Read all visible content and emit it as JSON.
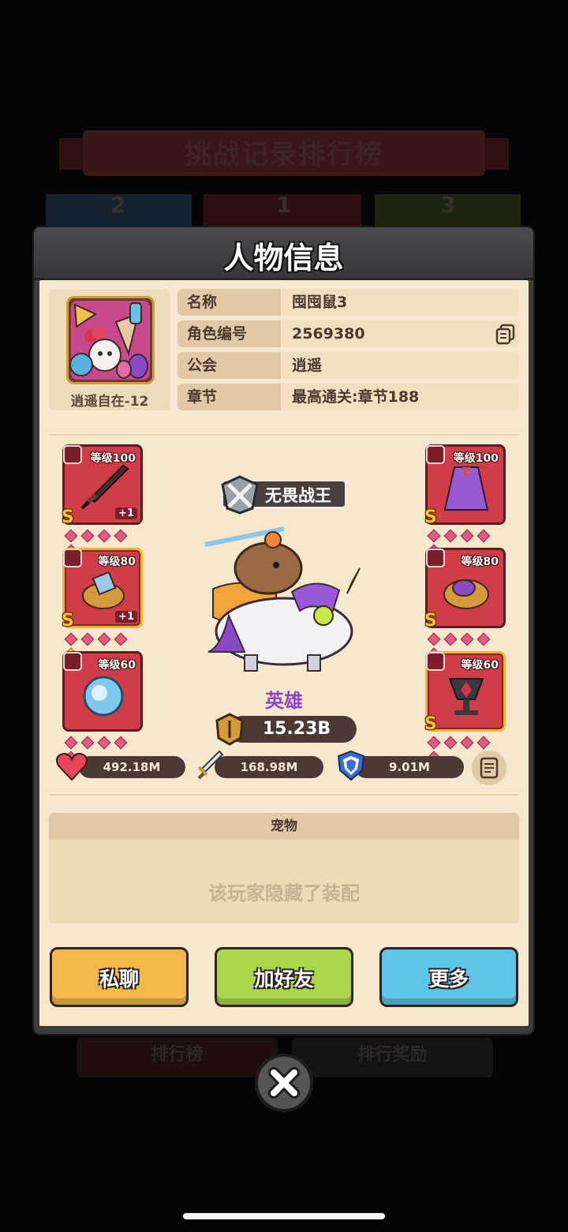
{
  "background": {
    "title": "挑战记录排行榜",
    "podium": [
      "2",
      "1",
      "3"
    ],
    "bottom_tabs": [
      "排行榜",
      "排行奖励"
    ]
  },
  "dialog": {
    "title": "人物信息"
  },
  "profile": {
    "avatar_label": "逍遥自在-12",
    "rows": [
      {
        "key": "名称",
        "value": "囤囤鼠3"
      },
      {
        "key": "角色编号",
        "value": "2569380"
      },
      {
        "key": "公会",
        "value": "逍遥"
      },
      {
        "key": "章节",
        "value": "最高通关:章节188"
      }
    ]
  },
  "equipment": {
    "left": [
      {
        "level": "等级100",
        "grade": "S",
        "plus": "+1",
        "slot": "weapon",
        "gems_filled": 5
      },
      {
        "level": "等级80",
        "grade": "S",
        "plus": "+1",
        "slot": "ring",
        "gems_filled": 4
      },
      {
        "level": "等级60",
        "grade": "",
        "plus": "",
        "slot": "necklace",
        "gems_filled": 5
      }
    ],
    "right": [
      {
        "level": "等级100",
        "grade": "S",
        "plus": "",
        "slot": "armor",
        "gems_filled": 5
      },
      {
        "level": "等级80",
        "grade": "S",
        "plus": "",
        "slot": "ring",
        "gems_filled": 5
      },
      {
        "level": "等级60",
        "grade": "S",
        "plus": "",
        "slot": "necklace",
        "gems_filled": 5
      }
    ]
  },
  "hero": {
    "title_badge": "无畏战王",
    "rank": "英雄",
    "power": "15.23B"
  },
  "stats": {
    "hp": "492.18M",
    "attack": "168.98M",
    "defense": "9.01M"
  },
  "pet": {
    "header": "宠物",
    "hidden_text": "该玩家隐藏了装配"
  },
  "actions": {
    "chat": "私聊",
    "add_friend": "加好友",
    "more": "更多"
  },
  "colors": {
    "chat_button": "#f3b84a",
    "add_friend_button": "#a9d64a",
    "more_button": "#5fc3e8",
    "rank_color": "#8b48c2"
  }
}
